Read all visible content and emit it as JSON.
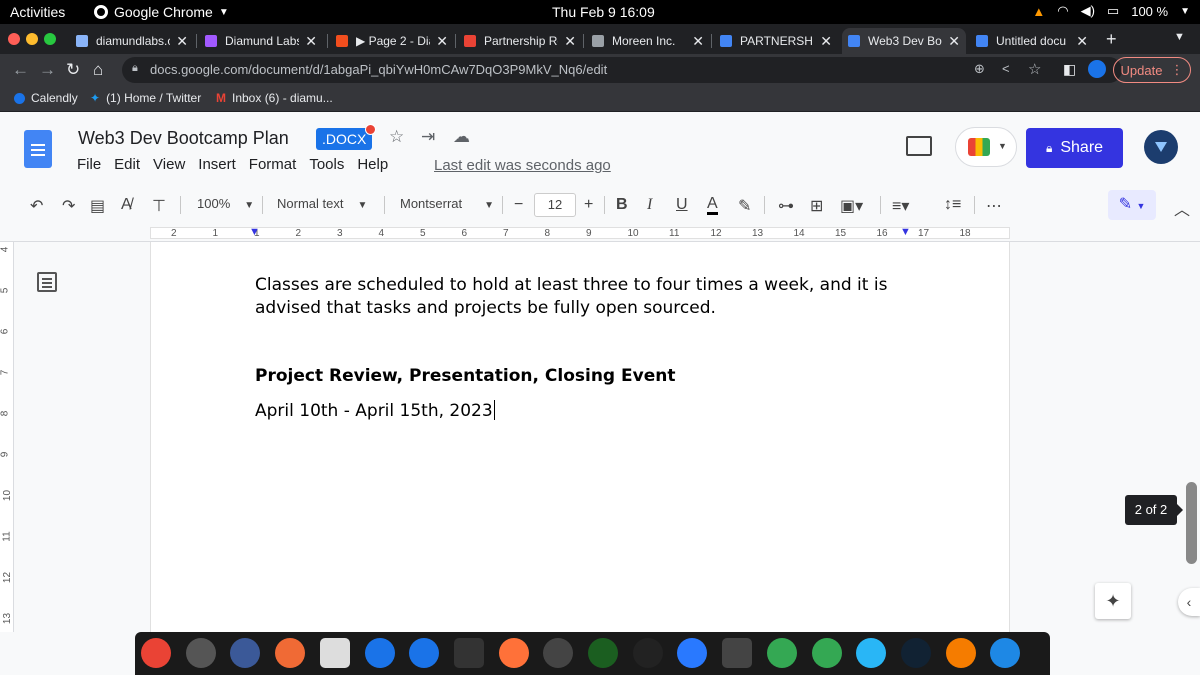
{
  "system_bar": {
    "activities": "Activities",
    "app_name": "Google Chrome",
    "clock": "Thu Feb 9  16:09",
    "battery": "100 %"
  },
  "tabs": [
    {
      "title": "diamundlabs.c",
      "color": "#8ab4f8"
    },
    {
      "title": "Diamund Labs",
      "color": "#a259ff"
    },
    {
      "title": "▶ Page 2 - Dia",
      "color": "#f24e1e"
    },
    {
      "title": "Partnership Re",
      "color": "#ea4335"
    },
    {
      "title": "Moreen Inc.",
      "color": "#9aa0a6"
    },
    {
      "title": "PARTNERSHIP",
      "color": "#4285f4"
    },
    {
      "title": "Web3 Dev Boo",
      "color": "#4285f4"
    },
    {
      "title": "Untitled docu",
      "color": "#4285f4"
    }
  ],
  "address_bar": {
    "url": "docs.google.com/document/d/1abgaPi_qbiYwH0mCAw7DqO3P9MkV_Nq6/edit",
    "update_label": "Update"
  },
  "bookmarks": [
    {
      "label": "Calendly"
    },
    {
      "label": "(1) Home / Twitter"
    },
    {
      "label": "Inbox (6) - diamu..."
    }
  ],
  "doc_header": {
    "title": "Web3 Dev Bootcamp Plan",
    "badge": ".DOCX",
    "menu": [
      "File",
      "Edit",
      "View",
      "Insert",
      "Format",
      "Tools",
      "Help"
    ],
    "last_edit": "Last edit was seconds ago",
    "share_label": "Share"
  },
  "toolbar": {
    "zoom": "100%",
    "style": "Normal text",
    "font": "Montserrat",
    "font_size": "12"
  },
  "ruler": {
    "labels": [
      "2",
      "1",
      "1",
      "2",
      "3",
      "4",
      "5",
      "6",
      "7",
      "8",
      "9",
      "10",
      "11",
      "12",
      "13",
      "14",
      "15",
      "16",
      "17",
      "18"
    ],
    "vertical_labels": [
      "4",
      "5",
      "6",
      "7",
      "8",
      "9",
      "10",
      "11",
      "12",
      "13"
    ]
  },
  "document": {
    "paragraph_line1": "Classes are scheduled to hold at least three to four times a week, and it is",
    "paragraph_line2": "advised that tasks and projects be fully open sourced.",
    "heading": "Project Review, Presentation, Closing Event",
    "date_range": "April 10th - April 15th, 2023"
  },
  "page_indicator": "2 of 2",
  "dock_icons": [
    "chrome-icon",
    "settings-icon",
    "screenshot-icon",
    "pencil-icon",
    "trash-icon",
    "feather-icon",
    "app-store-icon",
    "help-icon",
    "firefox-icon",
    "obs-icon",
    "circle-app-icon",
    "terminal-icon",
    "files-icon",
    "toggle-icon",
    "puzzle-icon",
    "globe-icon",
    "at-icon",
    "speedometer-icon",
    "vlc-icon",
    "un-icon"
  ]
}
